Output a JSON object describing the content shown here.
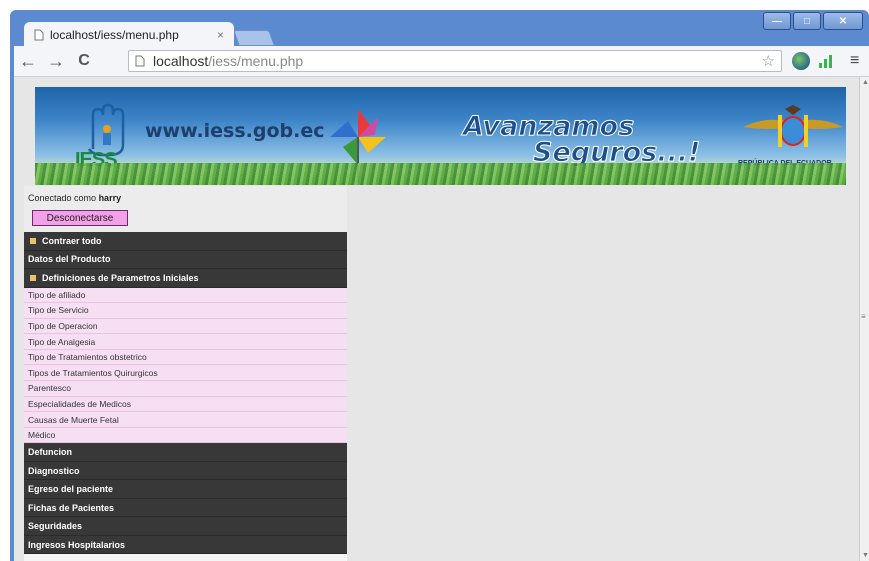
{
  "window": {
    "minimize": "—",
    "maximize": "□",
    "close": "✕"
  },
  "tab": {
    "title": "localhost/iess/menu.php",
    "close": "×"
  },
  "toolbar": {
    "back": "←",
    "forward": "→",
    "reload": "C",
    "url_host": "localhost",
    "url_path": "/iess/menu.php",
    "star": "☆",
    "menu": "≡"
  },
  "banner": {
    "logo": "IESS",
    "website": "www.iess.gob.ec",
    "slogan_line1": "Avanzamos",
    "slogan_line2": "Seguros...!",
    "country": "REPÚBLICA DEL ECUADOR"
  },
  "user": {
    "connected_prefix": "Conectado como",
    "username": "harry",
    "logout_label": "Desconectarse"
  },
  "menu": {
    "collapse_all": "Contraer todo",
    "datos_producto": "Datos del Producto",
    "definiciones": "Definiciones de Parametros Iniciales",
    "sub_items": [
      "Tipo de afiliado",
      "Tipo de Servicio",
      "Tipo de Operacion",
      "Tipo de Analgesia",
      "Tipo de Tratamientos obstetrico",
      "Tipos de Tratamientos Quirurgicos",
      "Parentesco",
      "Especialidades de Medicos",
      "Causas de Muerte Fetal",
      "Médico"
    ],
    "sections": [
      "Defuncion",
      "Diagnostico",
      "Egreso del paciente",
      "Fichas de Pacientes",
      "Seguridades",
      "Ingresos Hospitalarios"
    ]
  },
  "colors": {
    "chrome_blue": "#5b8ad0",
    "menu_dark": "#383838",
    "submenu_pink": "#f6dff2",
    "logout_pink": "#f2a0e8"
  }
}
